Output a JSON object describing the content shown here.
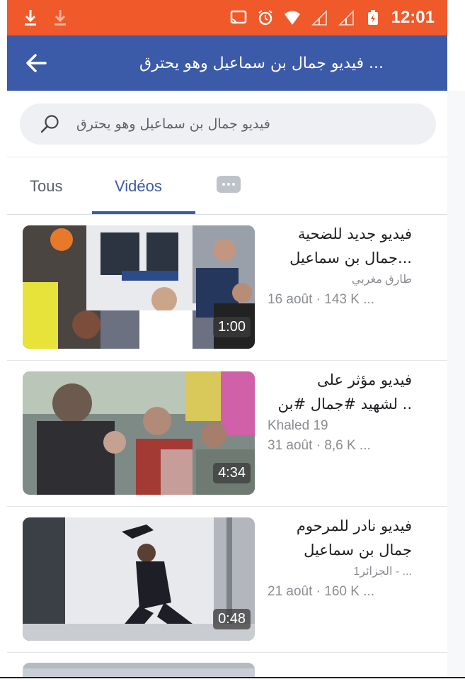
{
  "status_bar": {
    "time": "12:01",
    "color": "#f0592a"
  },
  "app_bar": {
    "title": "... فيديو جمال بن سماعيل وهو يحترق",
    "color": "#3b5aa8"
  },
  "search": {
    "query": "فيديو جمال بن سماعيل وهو يحترق"
  },
  "tabs": [
    {
      "label": "Tous"
    },
    {
      "label": "Vidéos",
      "active": true
    }
  ],
  "results": [
    {
      "title_line1": "فيديو جديد للضحية",
      "title_line2": "...جمال بن سماعيل",
      "author": "طارق مغربي",
      "meta": "16 août · 143 K ...",
      "duration": "1:00"
    },
    {
      "title_line1": "فيديو مؤثر على",
      "title_line2": ".. لشهيد #جمال #بن",
      "author": "Khaled 19",
      "meta": "31 août · 8,6 K ...",
      "duration": "4:34"
    },
    {
      "title_line1": "فيديو نادر للمرحوم",
      "title_line2": "جمال بن سماعيل",
      "author": "... - الجزائر1",
      "meta": "21 août · 160 K ...",
      "duration": "0:48"
    }
  ]
}
